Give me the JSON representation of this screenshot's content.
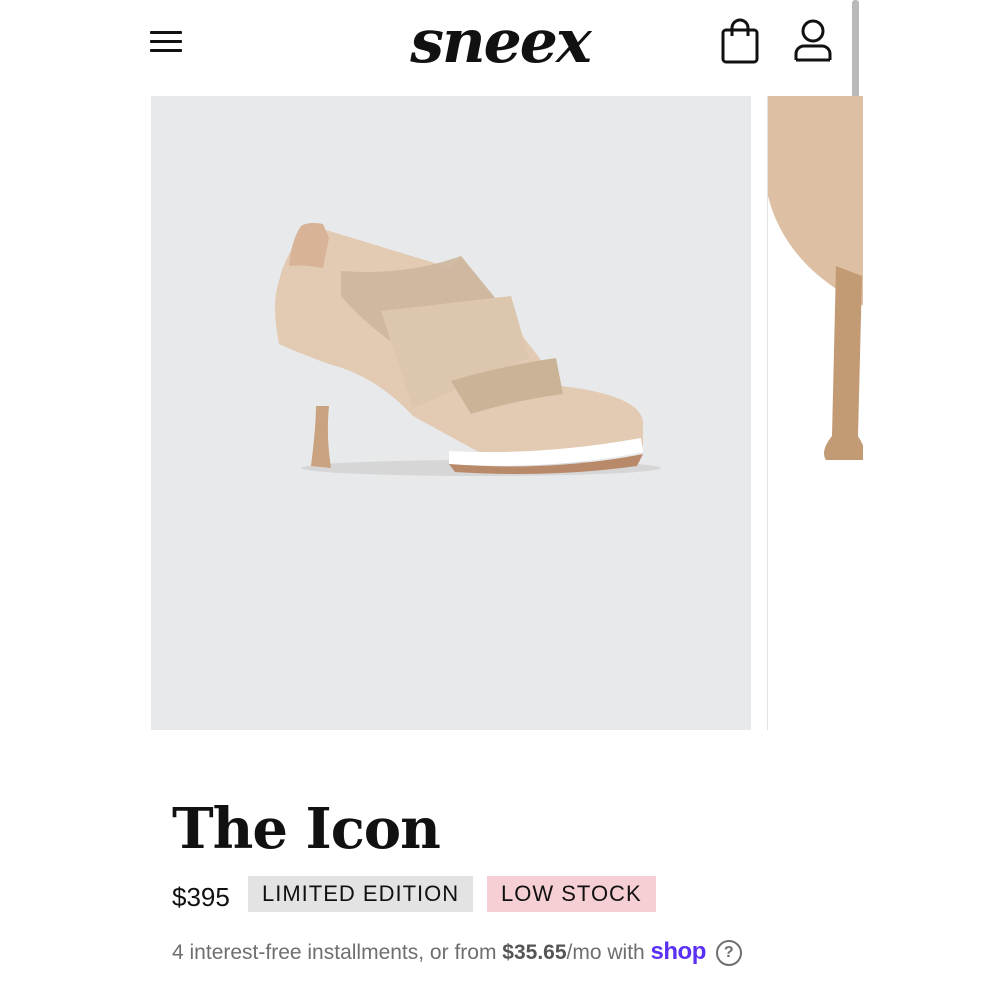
{
  "header": {
    "brand": "sneex",
    "icons": {
      "menu": "hamburger-menu-icon",
      "cart": "shopping-bag-icon",
      "account": "user-account-icon"
    }
  },
  "gallery": {
    "main_image": "beige-heeled-sneaker-bootie",
    "next_image": "heel-closeup"
  },
  "product": {
    "title": "The Icon",
    "price": "$395",
    "badges": [
      "LIMITED EDITION",
      "LOW STOCK"
    ]
  },
  "installments": {
    "prefix": "4 interest-free installments, or from ",
    "amount": "$35.65",
    "suffix": "/mo with ",
    "provider": "shop",
    "help": "?"
  },
  "colors": {
    "accent_shop": "#5a31f4",
    "badge_limited_bg": "#e3e3e3",
    "badge_low_stock_bg": "#f5cfd4",
    "image_bg": "#e8e9ea"
  }
}
